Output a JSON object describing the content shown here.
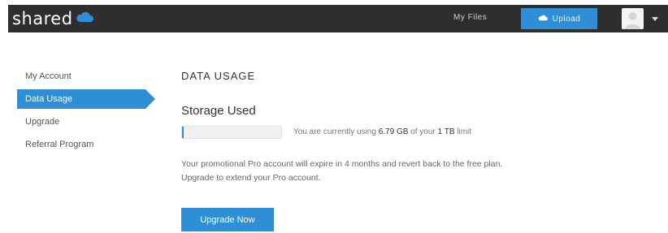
{
  "header": {
    "logo_text": "shared",
    "logo_icon": "cloud-icon",
    "nav_my_files": "My Files",
    "upload_label": "Upload",
    "upload_icon": "cloud-icon",
    "avatar_icon": "user-icon",
    "menu_icon": "caret-down-icon"
  },
  "sidebar": {
    "items": [
      {
        "label": "My Account",
        "active": false
      },
      {
        "label": "Data Usage",
        "active": true
      },
      {
        "label": "Upgrade",
        "active": false
      },
      {
        "label": "Referral Program",
        "active": false
      }
    ]
  },
  "main": {
    "section_title": "DATA USAGE",
    "storage_heading": "Storage Used",
    "usage_progress_fraction": 0.0066,
    "usage_prefix": "You are currently using ",
    "usage_amount": "6.79 GB",
    "usage_middle": " of your ",
    "usage_limit": "1 TB",
    "usage_suffix": " limit",
    "promo_line1": "Your promotional Pro account will expire in 4 months and revert back to the free plan.",
    "promo_line2": "Upgrade to extend your Pro account.",
    "upgrade_button": "Upgrade Now"
  },
  "colors": {
    "topbar": "#2e2e2e",
    "accent": "#2f8fd6"
  }
}
